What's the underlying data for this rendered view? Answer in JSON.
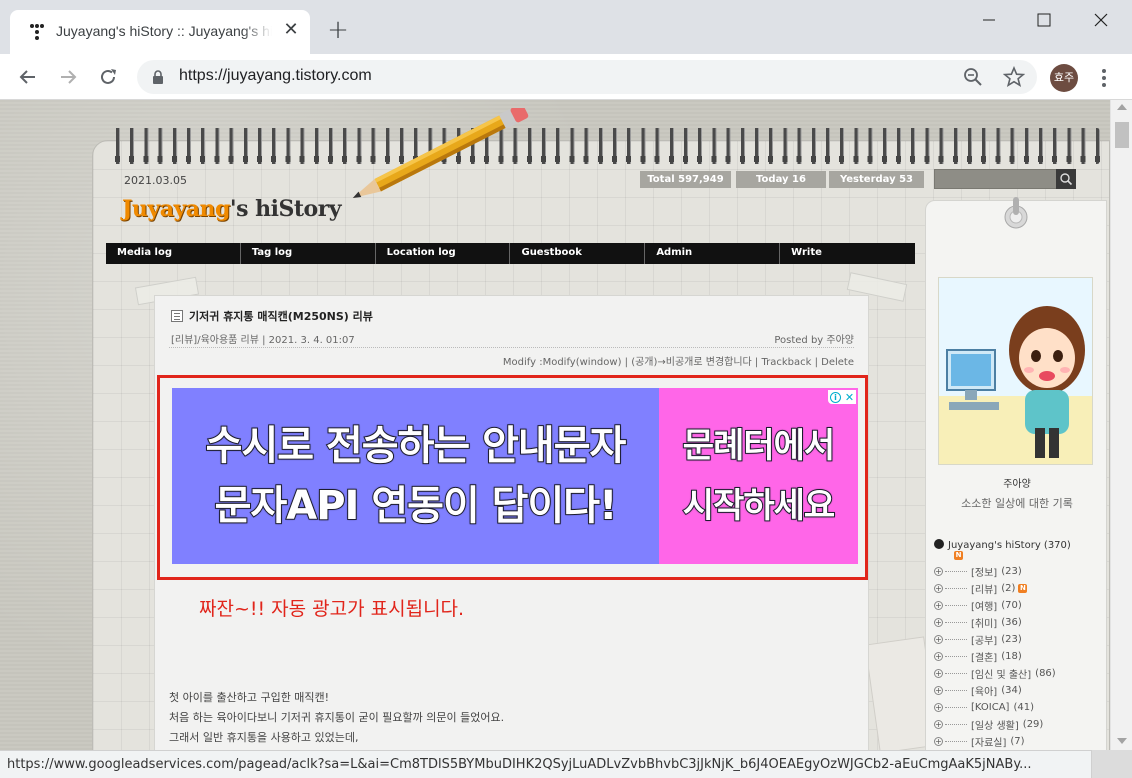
{
  "browser": {
    "tab_title": "Juyayang's hiStory :: Juyayang's hiStory",
    "url": "https://juyayang.tistory.com",
    "profile_initials": "효주",
    "status_url": "https://www.googleadservices.com/pagead/aclk?sa=L&ai=Cm8TDlS5BYMbuDIHK2QSyjLuADLvZvbBhvbC3jJkNjK_b6J4OEAEgyOzWJGCb2-aEuCmgAaK5jNABy..."
  },
  "blog": {
    "date": "2021.03.05",
    "stats": {
      "total": "Total 597,949",
      "today": "Today 16",
      "yesterday": "Yesterday 53"
    },
    "logo_main": "Juyayang",
    "logo_rest": "'s hiStory",
    "nav": [
      "Media log",
      "Tag log",
      "Location log",
      "Guestbook",
      "Admin",
      "Write"
    ]
  },
  "sidebar": {
    "profile_name": "주아양",
    "profile_desc": "소소한 일상에 대한 기록",
    "category_root": "Juyayang's hiStory (370)",
    "categories": [
      {
        "label": "[정보]",
        "count": "(23)",
        "new": false
      },
      {
        "label": "[리뷰]",
        "count": "(2)",
        "new": true
      },
      {
        "label": "[여행]",
        "count": "(70)",
        "new": false
      },
      {
        "label": "[취미]",
        "count": "(36)",
        "new": false
      },
      {
        "label": "[공부]",
        "count": "(23)",
        "new": false
      },
      {
        "label": "[결혼]",
        "count": "(18)",
        "new": false
      },
      {
        "label": "[임신 및 출산]",
        "count": "(86)",
        "new": false
      },
      {
        "label": "[육아]",
        "count": "(34)",
        "new": false
      },
      {
        "label": "[KOICA]",
        "count": "(41)",
        "new": false
      },
      {
        "label": "[일상 생활]",
        "count": "(29)",
        "new": false
      },
      {
        "label": "[자료실]",
        "count": "(7)",
        "new": false
      }
    ]
  },
  "post": {
    "title": "기저귀 휴지통 매직캔(M250NS) 리뷰",
    "meta": "[리뷰]/육아용품 리뷰 | 2021. 3. 4. 01:07",
    "author": "Posted by 주아양",
    "actions": "Modify :Modify(window) | (공개)→비공개로 변경합니다 | Trackback | Delete",
    "ad": {
      "left_line1": "수시로 전송하는 안내문자",
      "left_line2": "문자API 연동이 답이다!",
      "right_line1": "문례터에서",
      "right_line2": "시작하세요"
    },
    "annotation": "짜잔~!! 자동 광고가 표시됩니다.",
    "body": [
      "첫 아이를 출산하고 구입한 매직캔!",
      "처음 하는 육아이다보니 기저귀 휴지통이 굳이 필요할까 의문이 들었어요.",
      "그래서 일반 휴지통을 사용하고 있었는데,"
    ]
  },
  "icons": {
    "back": "arrow-left-icon",
    "forward": "arrow-right-icon",
    "reload": "reload-icon",
    "lock": "lock-icon",
    "zoom": "zoom-icon",
    "bookmark": "star-icon",
    "menu": "kebab-menu-icon"
  },
  "colors": {
    "ad_outline": "#e1251b",
    "ad_left_bg": "#8080ff",
    "ad_right_bg": "#ff66e8",
    "logo_orange": "#f08a00"
  }
}
